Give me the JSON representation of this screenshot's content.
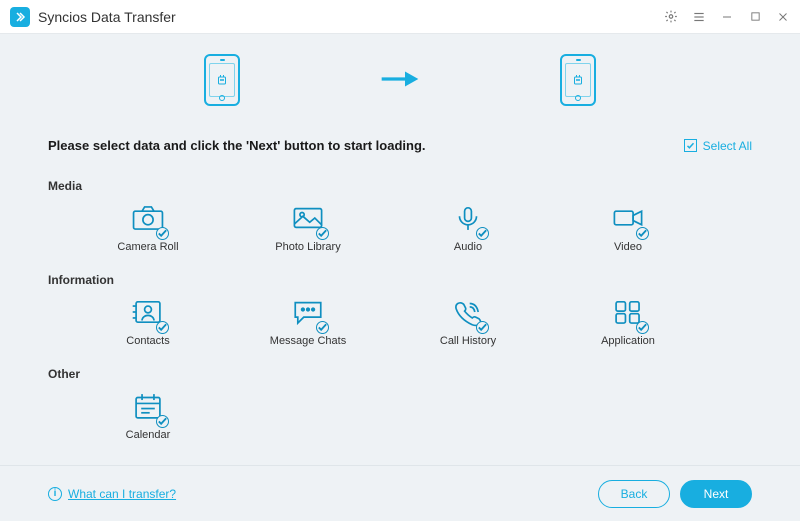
{
  "app": {
    "title": "Syncios Data Transfer"
  },
  "header": {
    "source_os": "android",
    "target_os": "android"
  },
  "instructions": "Please select data and click the 'Next' button to start loading.",
  "select_all": {
    "label": "Select All",
    "checked": true
  },
  "sections": {
    "media": {
      "label": "Media",
      "items": [
        {
          "icon": "camera-roll",
          "label": "Camera Roll",
          "selected": true
        },
        {
          "icon": "photo-library",
          "label": "Photo Library",
          "selected": true
        },
        {
          "icon": "audio",
          "label": "Audio",
          "selected": true
        },
        {
          "icon": "video",
          "label": "Video",
          "selected": true
        }
      ]
    },
    "information": {
      "label": "Information",
      "items": [
        {
          "icon": "contacts",
          "label": "Contacts",
          "selected": true
        },
        {
          "icon": "message-chats",
          "label": "Message Chats",
          "selected": true
        },
        {
          "icon": "call-history",
          "label": "Call History",
          "selected": true
        },
        {
          "icon": "application",
          "label": "Application",
          "selected": true
        }
      ]
    },
    "other": {
      "label": "Other",
      "items": [
        {
          "icon": "calendar",
          "label": "Calendar",
          "selected": true
        }
      ]
    }
  },
  "footer": {
    "help_label": "What can I transfer?",
    "back_label": "Back",
    "next_label": "Next"
  }
}
